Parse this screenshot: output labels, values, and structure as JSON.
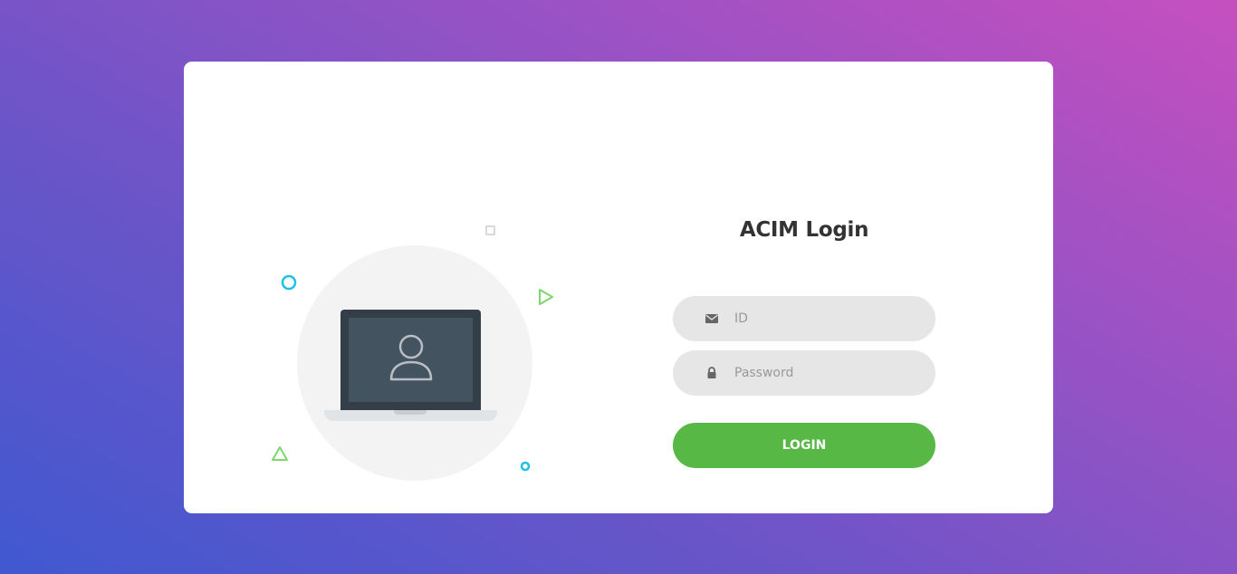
{
  "login": {
    "title": "ACIM Login",
    "id_placeholder": "ID",
    "password_placeholder": "Password",
    "button_label": "LOGIN"
  },
  "icons": {
    "id_field": "envelope-icon",
    "password_field": "lock-icon",
    "illustration": "laptop-user-icon"
  },
  "colors": {
    "button": "#57b846",
    "field_background": "#e6e6e6",
    "gradient_start": "#4058d0",
    "gradient_end": "#c64fbf"
  }
}
